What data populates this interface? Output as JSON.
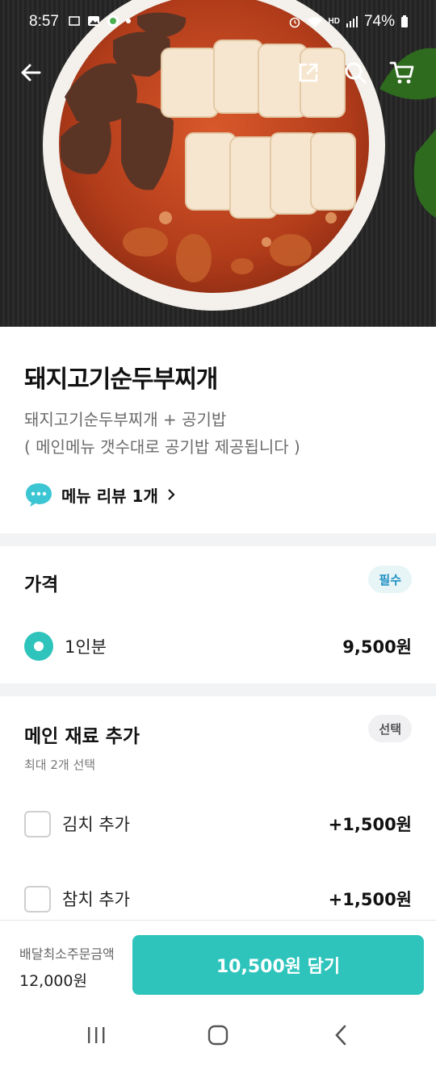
{
  "status_bar": {
    "time": "8:57",
    "battery": "74%",
    "network_label": "HD"
  },
  "hero": {
    "image_alt": "돼지고기순두부찌개 photo",
    "icons": [
      "back-arrow-icon",
      "share-icon",
      "search-icon",
      "cart-icon"
    ]
  },
  "menu": {
    "title": "돼지고기순두부찌개",
    "description_line1": "돼지고기순두부찌개 + 공기밥",
    "description_line2": "( 메인메뉴 갯수대로 공기밥 제공됩니다 )",
    "review_text": "메뉴 리뷰 1개"
  },
  "price_section": {
    "title": "가격",
    "badge": "필수",
    "options": [
      {
        "label": "1인분",
        "price": "9,500원",
        "selected": true
      }
    ]
  },
  "addon_section": {
    "title": "메인 재료 추가",
    "badge": "선택",
    "hint": "최대 2개 선택",
    "options": [
      {
        "label": "김치 추가",
        "price": "+1,500원",
        "checked": false
      },
      {
        "label": "참치 추가",
        "price": "+1,500원",
        "checked": false
      }
    ]
  },
  "bottom_bar": {
    "min_order_label": "배달최소주문금액",
    "min_order_value": "12,000원",
    "cart_button_label": "10,500원 담기"
  },
  "colors": {
    "accent": "#2ec4bc",
    "badge_required_text": "#1f8fc4",
    "section_gap": "#f2f3f5"
  }
}
